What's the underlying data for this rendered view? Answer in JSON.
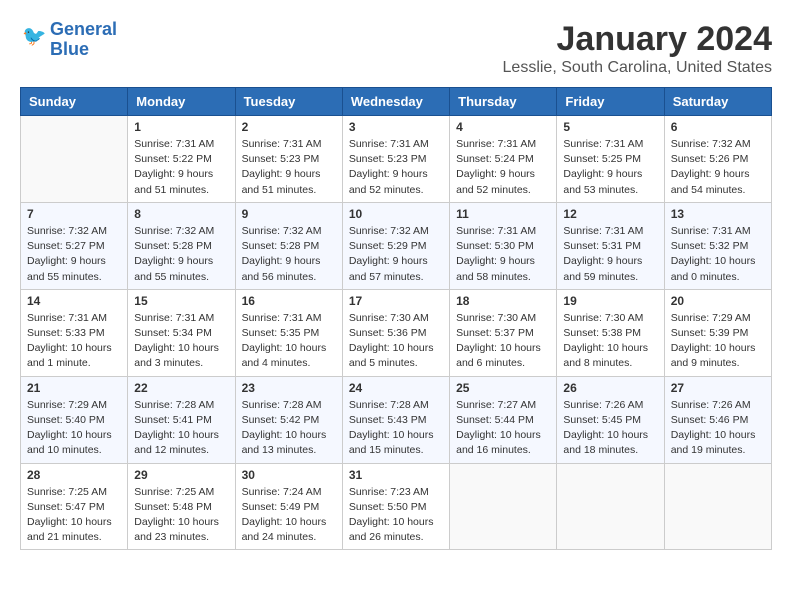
{
  "header": {
    "logo_line1": "General",
    "logo_line2": "Blue",
    "main_title": "January 2024",
    "subtitle": "Lesslie, South Carolina, United States"
  },
  "calendar": {
    "days_of_week": [
      "Sunday",
      "Monday",
      "Tuesday",
      "Wednesday",
      "Thursday",
      "Friday",
      "Saturday"
    ],
    "weeks": [
      [
        {
          "day": "",
          "sunrise": "",
          "sunset": "",
          "daylight": ""
        },
        {
          "day": "1",
          "sunrise": "Sunrise: 7:31 AM",
          "sunset": "Sunset: 5:22 PM",
          "daylight": "Daylight: 9 hours and 51 minutes."
        },
        {
          "day": "2",
          "sunrise": "Sunrise: 7:31 AM",
          "sunset": "Sunset: 5:23 PM",
          "daylight": "Daylight: 9 hours and 51 minutes."
        },
        {
          "day": "3",
          "sunrise": "Sunrise: 7:31 AM",
          "sunset": "Sunset: 5:23 PM",
          "daylight": "Daylight: 9 hours and 52 minutes."
        },
        {
          "day": "4",
          "sunrise": "Sunrise: 7:31 AM",
          "sunset": "Sunset: 5:24 PM",
          "daylight": "Daylight: 9 hours and 52 minutes."
        },
        {
          "day": "5",
          "sunrise": "Sunrise: 7:31 AM",
          "sunset": "Sunset: 5:25 PM",
          "daylight": "Daylight: 9 hours and 53 minutes."
        },
        {
          "day": "6",
          "sunrise": "Sunrise: 7:32 AM",
          "sunset": "Sunset: 5:26 PM",
          "daylight": "Daylight: 9 hours and 54 minutes."
        }
      ],
      [
        {
          "day": "7",
          "sunrise": "Sunrise: 7:32 AM",
          "sunset": "Sunset: 5:27 PM",
          "daylight": "Daylight: 9 hours and 55 minutes."
        },
        {
          "day": "8",
          "sunrise": "Sunrise: 7:32 AM",
          "sunset": "Sunset: 5:28 PM",
          "daylight": "Daylight: 9 hours and 55 minutes."
        },
        {
          "day": "9",
          "sunrise": "Sunrise: 7:32 AM",
          "sunset": "Sunset: 5:28 PM",
          "daylight": "Daylight: 9 hours and 56 minutes."
        },
        {
          "day": "10",
          "sunrise": "Sunrise: 7:32 AM",
          "sunset": "Sunset: 5:29 PM",
          "daylight": "Daylight: 9 hours and 57 minutes."
        },
        {
          "day": "11",
          "sunrise": "Sunrise: 7:31 AM",
          "sunset": "Sunset: 5:30 PM",
          "daylight": "Daylight: 9 hours and 58 minutes."
        },
        {
          "day": "12",
          "sunrise": "Sunrise: 7:31 AM",
          "sunset": "Sunset: 5:31 PM",
          "daylight": "Daylight: 9 hours and 59 minutes."
        },
        {
          "day": "13",
          "sunrise": "Sunrise: 7:31 AM",
          "sunset": "Sunset: 5:32 PM",
          "daylight": "Daylight: 10 hours and 0 minutes."
        }
      ],
      [
        {
          "day": "14",
          "sunrise": "Sunrise: 7:31 AM",
          "sunset": "Sunset: 5:33 PM",
          "daylight": "Daylight: 10 hours and 1 minute."
        },
        {
          "day": "15",
          "sunrise": "Sunrise: 7:31 AM",
          "sunset": "Sunset: 5:34 PM",
          "daylight": "Daylight: 10 hours and 3 minutes."
        },
        {
          "day": "16",
          "sunrise": "Sunrise: 7:31 AM",
          "sunset": "Sunset: 5:35 PM",
          "daylight": "Daylight: 10 hours and 4 minutes."
        },
        {
          "day": "17",
          "sunrise": "Sunrise: 7:30 AM",
          "sunset": "Sunset: 5:36 PM",
          "daylight": "Daylight: 10 hours and 5 minutes."
        },
        {
          "day": "18",
          "sunrise": "Sunrise: 7:30 AM",
          "sunset": "Sunset: 5:37 PM",
          "daylight": "Daylight: 10 hours and 6 minutes."
        },
        {
          "day": "19",
          "sunrise": "Sunrise: 7:30 AM",
          "sunset": "Sunset: 5:38 PM",
          "daylight": "Daylight: 10 hours and 8 minutes."
        },
        {
          "day": "20",
          "sunrise": "Sunrise: 7:29 AM",
          "sunset": "Sunset: 5:39 PM",
          "daylight": "Daylight: 10 hours and 9 minutes."
        }
      ],
      [
        {
          "day": "21",
          "sunrise": "Sunrise: 7:29 AM",
          "sunset": "Sunset: 5:40 PM",
          "daylight": "Daylight: 10 hours and 10 minutes."
        },
        {
          "day": "22",
          "sunrise": "Sunrise: 7:28 AM",
          "sunset": "Sunset: 5:41 PM",
          "daylight": "Daylight: 10 hours and 12 minutes."
        },
        {
          "day": "23",
          "sunrise": "Sunrise: 7:28 AM",
          "sunset": "Sunset: 5:42 PM",
          "daylight": "Daylight: 10 hours and 13 minutes."
        },
        {
          "day": "24",
          "sunrise": "Sunrise: 7:28 AM",
          "sunset": "Sunset: 5:43 PM",
          "daylight": "Daylight: 10 hours and 15 minutes."
        },
        {
          "day": "25",
          "sunrise": "Sunrise: 7:27 AM",
          "sunset": "Sunset: 5:44 PM",
          "daylight": "Daylight: 10 hours and 16 minutes."
        },
        {
          "day": "26",
          "sunrise": "Sunrise: 7:26 AM",
          "sunset": "Sunset: 5:45 PM",
          "daylight": "Daylight: 10 hours and 18 minutes."
        },
        {
          "day": "27",
          "sunrise": "Sunrise: 7:26 AM",
          "sunset": "Sunset: 5:46 PM",
          "daylight": "Daylight: 10 hours and 19 minutes."
        }
      ],
      [
        {
          "day": "28",
          "sunrise": "Sunrise: 7:25 AM",
          "sunset": "Sunset: 5:47 PM",
          "daylight": "Daylight: 10 hours and 21 minutes."
        },
        {
          "day": "29",
          "sunrise": "Sunrise: 7:25 AM",
          "sunset": "Sunset: 5:48 PM",
          "daylight": "Daylight: 10 hours and 23 minutes."
        },
        {
          "day": "30",
          "sunrise": "Sunrise: 7:24 AM",
          "sunset": "Sunset: 5:49 PM",
          "daylight": "Daylight: 10 hours and 24 minutes."
        },
        {
          "day": "31",
          "sunrise": "Sunrise: 7:23 AM",
          "sunset": "Sunset: 5:50 PM",
          "daylight": "Daylight: 10 hours and 26 minutes."
        },
        {
          "day": "",
          "sunrise": "",
          "sunset": "",
          "daylight": ""
        },
        {
          "day": "",
          "sunrise": "",
          "sunset": "",
          "daylight": ""
        },
        {
          "day": "",
          "sunrise": "",
          "sunset": "",
          "daylight": ""
        }
      ]
    ]
  }
}
